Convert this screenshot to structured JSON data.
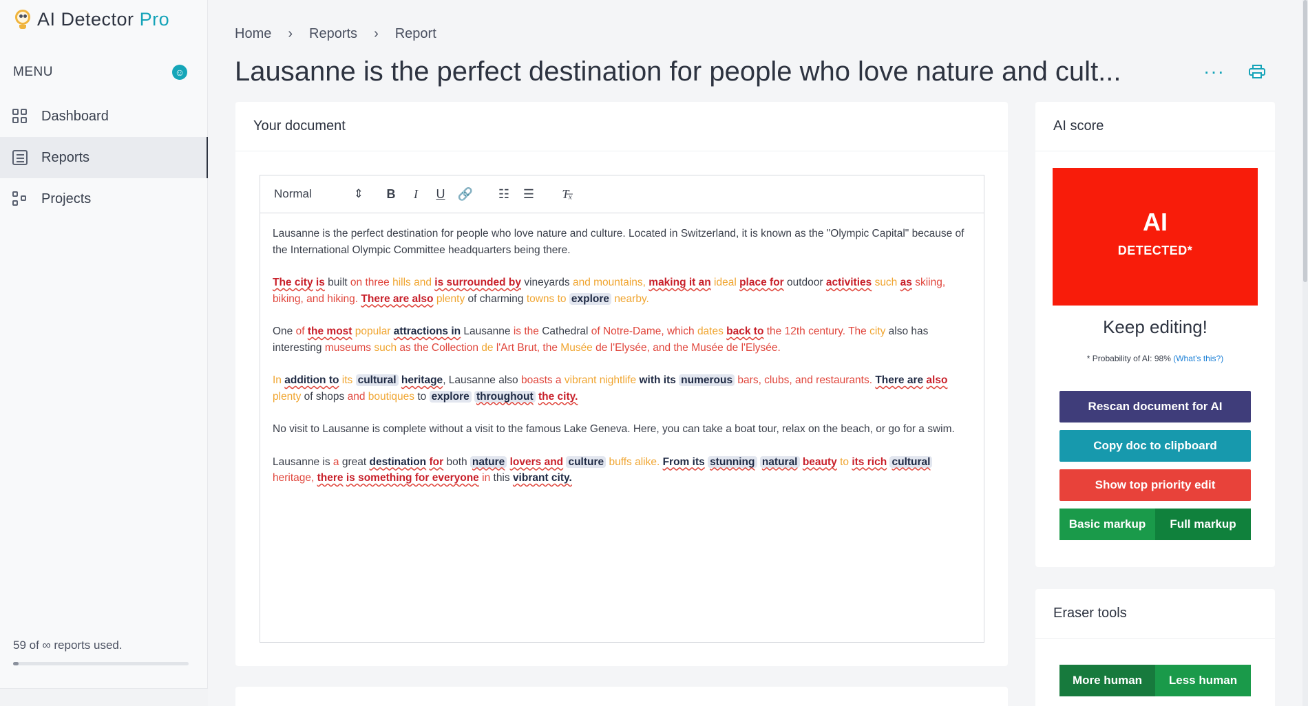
{
  "app": {
    "logo_main": "AI Detector ",
    "logo_accent": "Pro"
  },
  "sidebar": {
    "menu_label": "MENU",
    "items": [
      {
        "label": "Dashboard",
        "icon": "dashboard-icon"
      },
      {
        "label": "Reports",
        "icon": "reports-icon",
        "active": true
      },
      {
        "label": "Projects",
        "icon": "projects-icon"
      }
    ],
    "usage_text": "59 of ∞ reports used."
  },
  "breadcrumb": [
    "Home",
    "Reports",
    "Report"
  ],
  "page_title": "Lausanne is the perfect destination for people who love nature and cult...",
  "document_card": {
    "title": "Your document",
    "format_select": "Normal"
  },
  "document": {
    "p1": {
      "a": "Lausanne is the perfect destination for people who love nature and culture. Located in Switzerland, it is known as the \"Olympic Capital\" because of the International Olympic Committee headquarters being there."
    },
    "p2": {
      "a": "The city",
      "b": "is",
      "c": " built ",
      "d": "on three ",
      "e": "hills and ",
      "f": "is surrounded by",
      "g": " vineyards ",
      "h": "and mountains,",
      "i": "making it an",
      "j": "ideal",
      "k": "place for",
      "l": " outdoor ",
      "m": "activities",
      "n": "such",
      "o": "as",
      "p": "skiing, biking, and hiking.",
      "q": "There are also",
      "r": "plenty",
      "s": " of charming ",
      "t": "towns to",
      "u": "explore",
      "v": "nearby."
    },
    "p3": {
      "a": "One ",
      "b": "of",
      "c": "the most",
      "d": "popular",
      "e": "attractions in",
      "f": " Lausanne ",
      "g": "is the",
      "h": " Cathedral ",
      "i": "of Notre-Dame, which",
      "j": "dates",
      "k": "back to",
      "l": "the 12th century. The",
      "m": "city",
      "n": " also has interesting ",
      "o": "museums",
      "p": "such",
      "q": "as the Collection",
      "r": "de",
      "s": "l'Art Brut, the",
      "t": "Musée",
      "u": "de l'Elysée, and the Musée de l'Elysée."
    },
    "p4": {
      "a": "In",
      "b": "addition to",
      "c": "its",
      "d": "cultural",
      "e": "heritage",
      "f": ", Lausanne also ",
      "g": "boasts a",
      "h": "vibrant",
      "i": "nightlife",
      "j": "with its",
      "k": "numerous",
      "l": "bars, clubs, and restaurants.",
      "m": "There are",
      "n": "also",
      "o": "plenty",
      "p": " of shops ",
      "q": "and",
      "r": "boutiques",
      "s": " to ",
      "t": "explore",
      "u": "throughout",
      "v": "the city."
    },
    "p5": {
      "a": "No visit to Lausanne is complete without a visit to the famous Lake Geneva. Here, you can take a boat tour, relax on the beach, or go for a swim."
    },
    "p6": {
      "a": "Lausanne is ",
      "b": "a",
      "c": " great ",
      "d": "destination",
      "e": "for",
      "f": " both ",
      "g": "nature",
      "h": "lovers and",
      "i": "culture",
      "j": "buffs alike.",
      "k": "From its",
      "l": "stunning",
      "m": "natural",
      "n": "beauty",
      "o": "to",
      "p": "its rich",
      "q": "cultural",
      "r": "heritage,",
      "s": "there",
      "t": "is something for everyone",
      "u": "in",
      "v": " this ",
      "w": "vibrant city."
    }
  },
  "score_card": {
    "title": "AI score",
    "badge_big": "AI",
    "badge_small": "DETECTED*",
    "status": "Keep editing!",
    "probability": "* Probability of AI: 98%",
    "whats_this": "(What's this?)",
    "rescan": "Rescan document for AI",
    "copy": "Copy doc to clipboard",
    "priority": "Show top priority edit",
    "basic_markup": "Basic markup",
    "full_markup": "Full markup"
  },
  "eraser_card": {
    "title": "Eraser tools",
    "more_human": "More human",
    "less_human": "Less human"
  },
  "colors": {
    "ai_detected": "#f81c0a",
    "rescan": "#3f3d7a",
    "copy": "#1799ad",
    "priority": "#e8423a",
    "markup_basic": "#1a9a4a",
    "markup_full": "#10813c",
    "human_more": "#177a3d",
    "human_less": "#1a9a4a",
    "accent": "#14a3b8"
  }
}
